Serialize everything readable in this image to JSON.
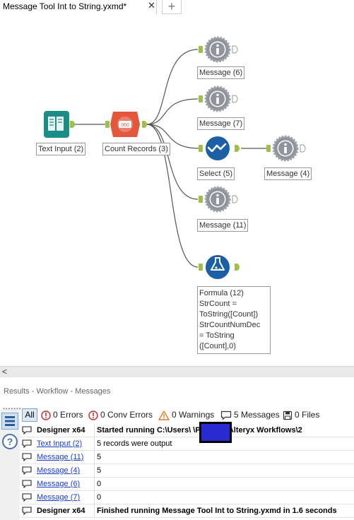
{
  "tab": {
    "title": "Message Tool Int to String.yxmd*",
    "close": "✕",
    "add": "+"
  },
  "tools": {
    "text_input": {
      "label": "Text Input (2)"
    },
    "count_records": {
      "label": "Count Records (3)"
    },
    "message6": {
      "label": "Message (6)"
    },
    "message7": {
      "label": "Message (7)"
    },
    "select5": {
      "label": "Select (5)"
    },
    "message4": {
      "label": "Message (4)"
    },
    "message11": {
      "label": "Message (11)"
    },
    "formula12": {
      "lines": [
        "Formula (12)",
        "StrCount =",
        "ToString([Count])",
        "StrCountNumDec",
        "= ToString",
        "([Count],0)"
      ]
    }
  },
  "scroll": {
    "left_arrow": "<"
  },
  "results": {
    "header": "Results - Workflow - Messages",
    "filters": {
      "all": "All",
      "errors": "0 Errors",
      "conv_errors": "0 Conv Errors",
      "warnings": "0 Warnings",
      "messages": "5 Messages",
      "files": "0 Files"
    },
    "rows": [
      {
        "source": "Designer x64",
        "text": "Started running C:\\Users\\        \\Projects\\Alteryx Workflows\\2"
      },
      {
        "source": "Text Input (2)",
        "text": "5 records were output"
      },
      {
        "source": "Message (11)",
        "text": "5"
      },
      {
        "source": "Message (4)",
        "text": "5"
      },
      {
        "source": "Message (6)",
        "text": "0"
      },
      {
        "source": "Message (7)",
        "text": "0"
      },
      {
        "source": "Designer x64",
        "text": "Finished running Message Tool Int to String.yxmd in 1.6 seconds"
      }
    ]
  },
  "colors": {
    "message_gear": "#9aa0a6",
    "text_input_teal": "#1c8c86",
    "count_records_red": "#e4573d",
    "select_blue": "#1b5fa6",
    "formula_blue": "#1b5fa6",
    "anchor_green": "#9fc046",
    "link_blue": "#1a3ecf"
  }
}
